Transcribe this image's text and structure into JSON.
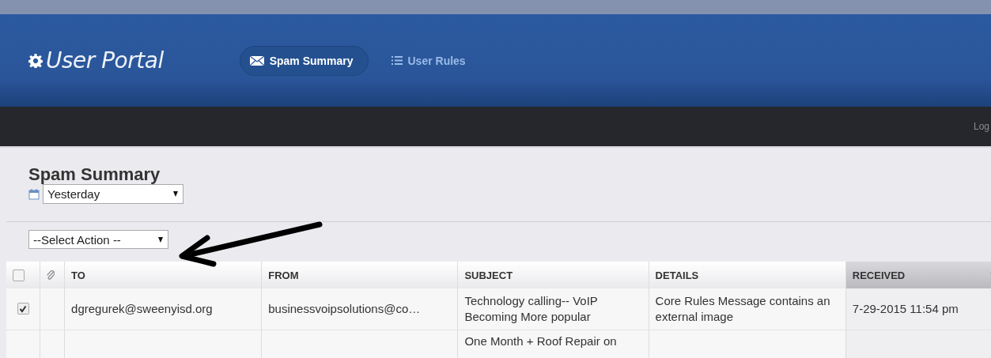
{
  "header": {
    "logo": "User Portal",
    "nav": [
      {
        "label": "Spam Summary",
        "kind": "mail",
        "selected": true
      },
      {
        "label": "User Rules",
        "kind": "rules",
        "selected": false
      }
    ]
  },
  "toolbar": {
    "link": "Log"
  },
  "page": {
    "title": "Spam Summary",
    "date_filter": {
      "value": "Yesterday"
    },
    "action_select": {
      "value": "--Select Action --"
    }
  },
  "table": {
    "columns": [
      {
        "kind": "checkbox",
        "checked": false
      },
      {
        "kind": "attachment"
      },
      {
        "kind": "text",
        "label": "TO",
        "sorted": false
      },
      {
        "kind": "text",
        "label": "FROM",
        "sorted": false
      },
      {
        "kind": "text",
        "label": "SUBJECT",
        "sorted": false
      },
      {
        "kind": "text",
        "label": "DETAILS",
        "sorted": false
      },
      {
        "kind": "text",
        "label": "RECEIVED",
        "sorted": true
      }
    ],
    "rows": [
      {
        "checked": true,
        "cells": [
          "",
          "",
          "dgregurek@sweenyisd.org",
          "businessvoipsolutions@co…",
          "Technology calling-- VoIP Becoming More popular",
          "Core Rules Message contains an external image",
          "7-29-2015 11:54 pm"
        ]
      },
      {
        "cells": [
          "",
          "",
          "",
          "",
          "One Month + Roof Repair on",
          "",
          ""
        ]
      }
    ]
  }
}
